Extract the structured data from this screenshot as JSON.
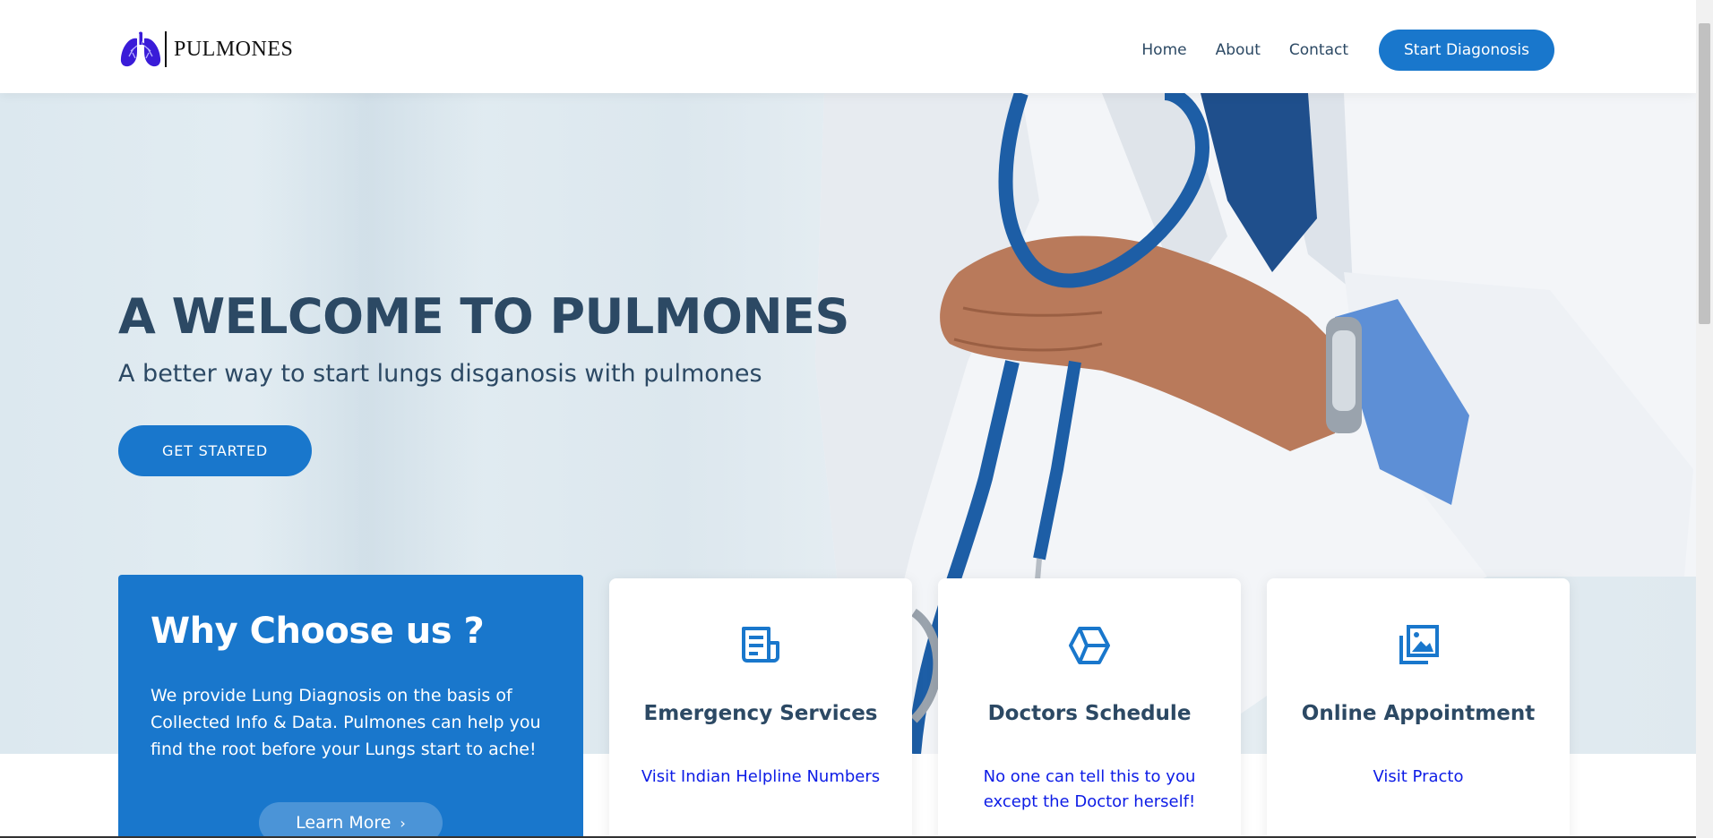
{
  "header": {
    "logo_text": "PULMONES",
    "nav": {
      "home": "Home",
      "about": "About",
      "contact": "Contact"
    },
    "cta_label": "Start Diagonosis"
  },
  "hero": {
    "title": "A WELCOME TO PULMONES",
    "subtitle": "A better way to start lungs disganosis with pulmones",
    "button_label": "GET STARTED"
  },
  "why": {
    "title": "Why Choose us ?",
    "text": "We provide Lung Diagnosis on the basis of Collected Info & Data. Pulmones can help you find the root before your Lungs start to ache!",
    "button_label": "Learn More"
  },
  "cards": [
    {
      "icon": "receipt-icon",
      "title": "Emergency Services",
      "link": "Visit Indian Helpline Numbers"
    },
    {
      "icon": "cube-icon",
      "title": "Doctors Schedule",
      "link": "No one can tell this to you except the Doctor herself!"
    },
    {
      "icon": "images-icon",
      "title": "Online Appointment",
      "link": "Visit Practo"
    }
  ],
  "colors": {
    "accent": "#1977cc",
    "heading": "#2c4964",
    "link": "#0d1ce6",
    "logo_purple": "#3a1cd8"
  }
}
